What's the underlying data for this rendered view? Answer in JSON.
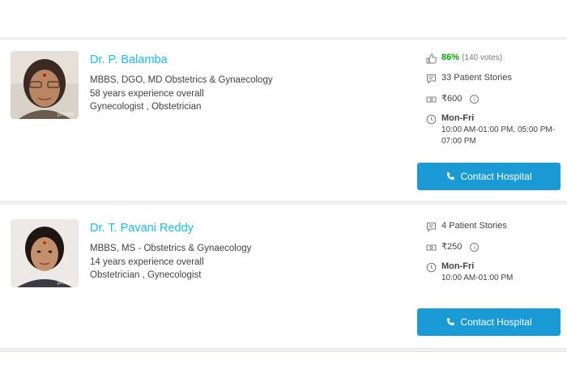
{
  "doctors": [
    {
      "name": "Dr. P. Balamba",
      "qualification": "MBBS, DGO, MD   Obstetrics & Gynaecology",
      "experience": "58 years experience overall",
      "specialties": "Gynecologist , Obstetrician",
      "rating_percent": "86%",
      "votes": "(140 votes)",
      "stories": "33 Patient Stories",
      "fee": "₹600",
      "days": "Mon-Fri",
      "timings": "10:00 AM-01:00 PM, 05:00 PM-07:00 PM",
      "contact_label": "Contact Hospital",
      "photo_watermark": "practo"
    },
    {
      "name": "Dr. T. Pavani Reddy",
      "qualification": "MBBS, MS - Obstetrics & Gynaecology",
      "experience": "14 years experience overall",
      "specialties": "Obstetrician , Gynecologist",
      "stories": "4 Patient Stories",
      "fee": "₹250",
      "days": "Mon-Fri",
      "timings": "10:00 AM-01:00 PM",
      "contact_label": "Contact Hospital",
      "photo_watermark": "practo"
    }
  ],
  "icons": {
    "thumbs_up": "thumbs-up-icon",
    "stories": "chat-icon",
    "fee": "money-icon",
    "timings": "clock-icon",
    "phone": "phone-icon",
    "info": "info-icon"
  },
  "colors": {
    "name_link": "#14bef0",
    "button": "#1b9bd6",
    "rating": "#01a400"
  }
}
